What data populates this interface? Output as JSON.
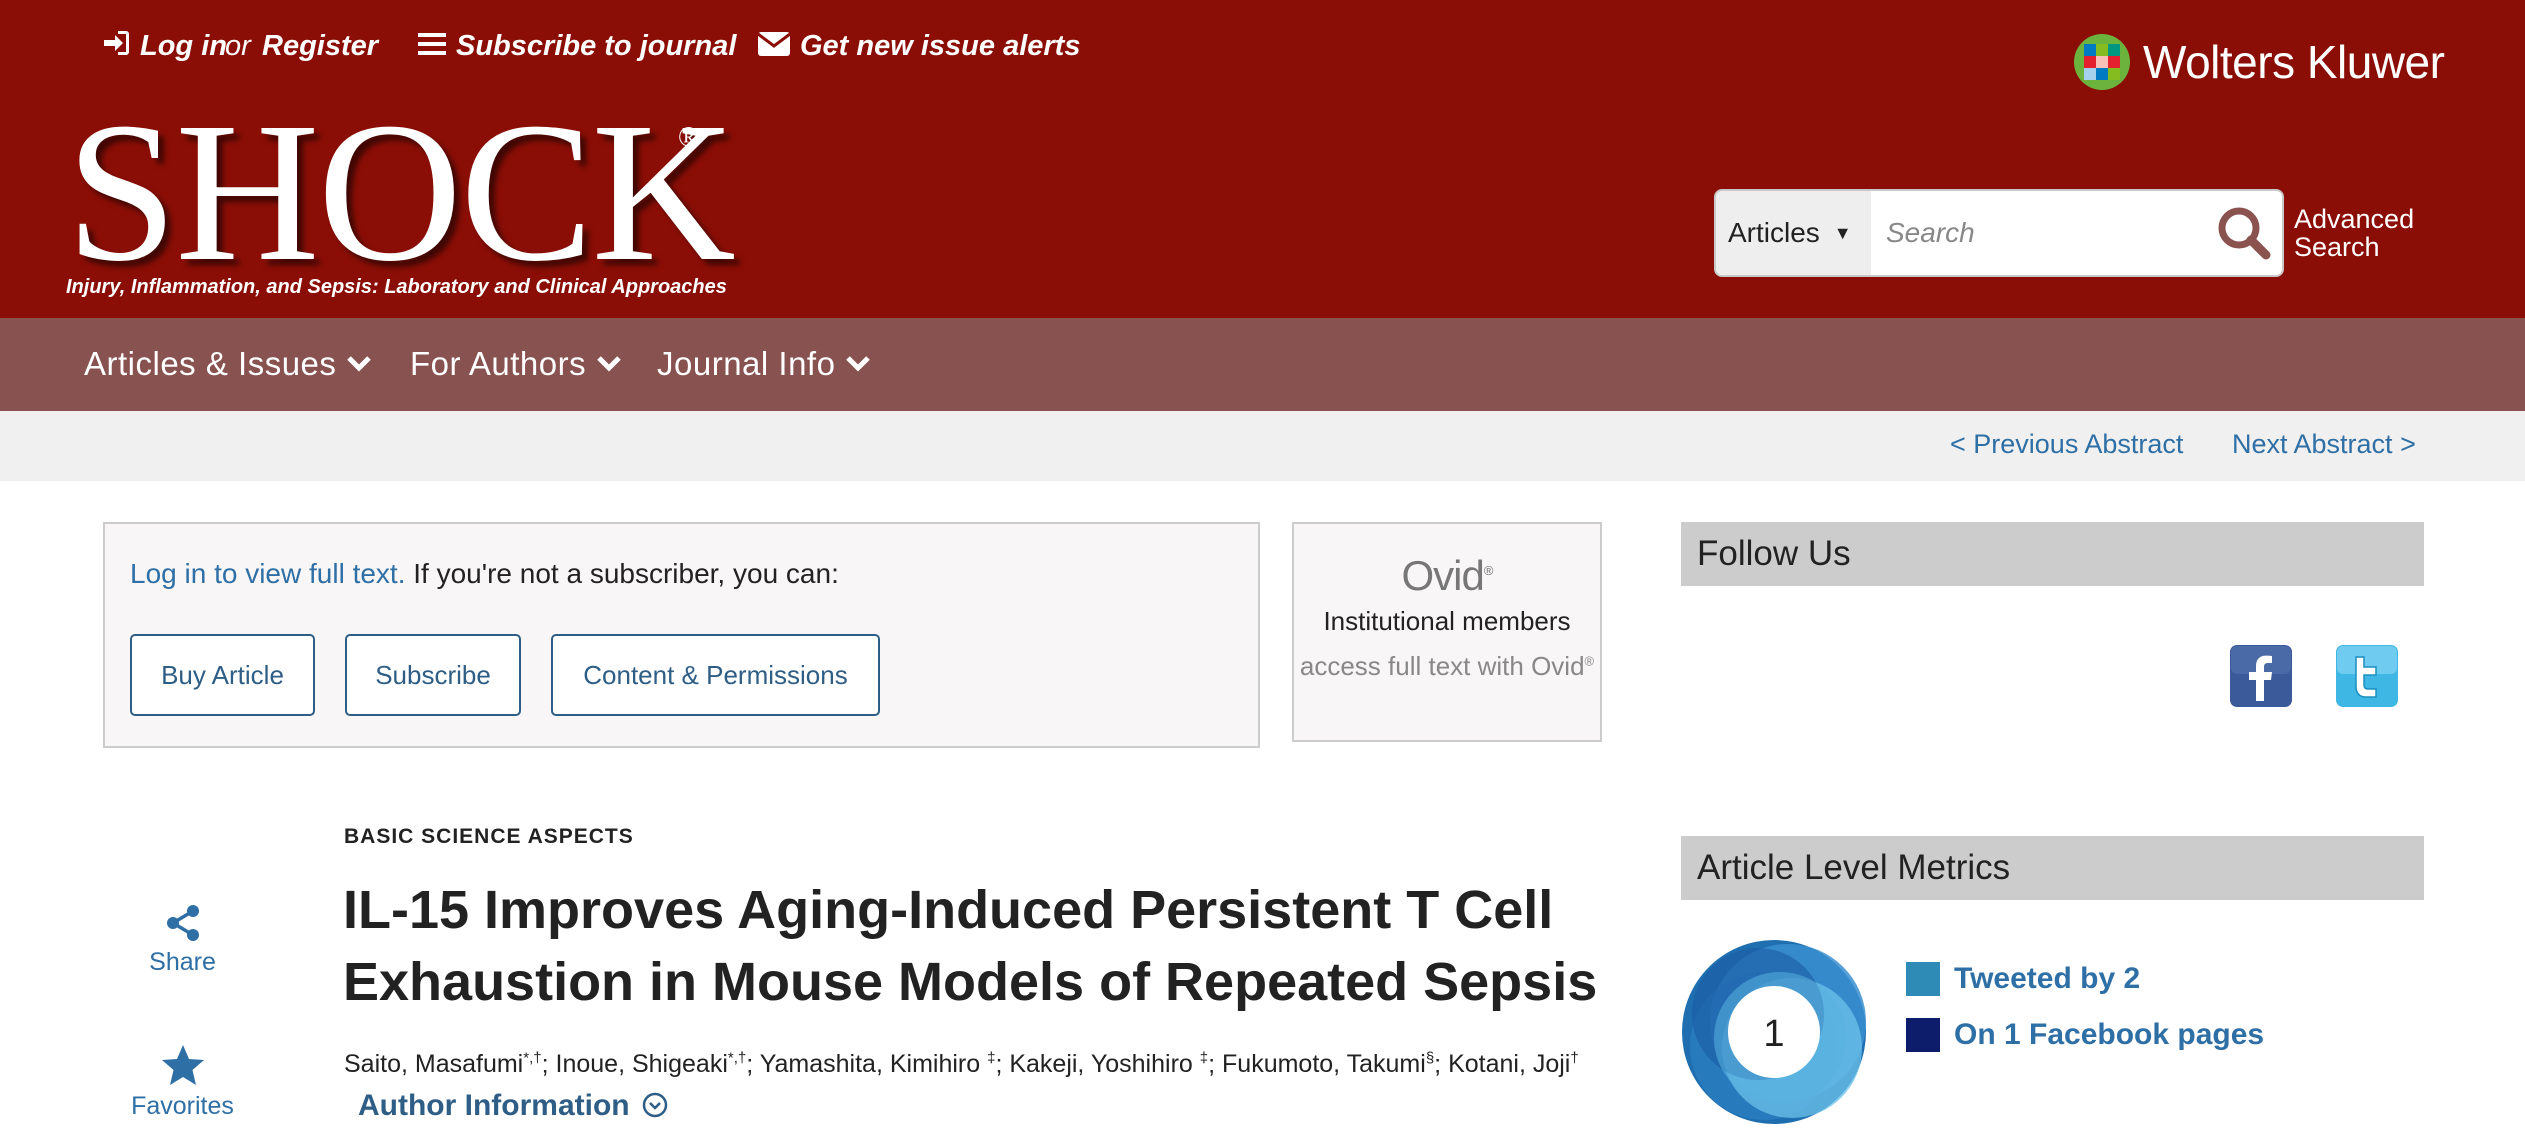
{
  "header": {
    "login": "Log in",
    "or": "or",
    "register": "Register",
    "subscribe": "Subscribe to journal",
    "alerts": "Get new issue alerts",
    "publisher": "Wolters Kluwer",
    "journal_logo": "SHOCK",
    "logo_mark": "®",
    "tagline": "Injury, Inflammation, and Sepsis: Laboratory and Clinical Approaches",
    "search": {
      "scope": "Articles",
      "placeholder": "Search",
      "advanced": "Advanced Search"
    },
    "colors": {
      "header_bg": "#8b0e06",
      "nav_bg": "#875250",
      "accent": "#2e6fa6"
    }
  },
  "nav": {
    "items": [
      "Articles & Issues",
      "For Authors",
      "Journal Info"
    ]
  },
  "pager": {
    "previous": "< Previous Abstract",
    "next": "Next Abstract >"
  },
  "access": {
    "login_text": "Log in to view full text.",
    "rest_text": " If you're not a subscriber, you can:",
    "buttons": [
      "Buy Article",
      "Subscribe",
      "Content & Permissions"
    ]
  },
  "ovid": {
    "logo": "Ovid",
    "text_1": "Institutional members",
    "text_link": "access full text with Ovid",
    "reg": "®"
  },
  "sidebar": {
    "follow_us": "Follow Us",
    "social_icons": [
      "facebook-icon",
      "twitter-icon"
    ],
    "metrics_title": "Article Level Metrics",
    "altmetric_score": "1",
    "metrics": [
      {
        "label": "Tweeted by 2",
        "color": "#2e8bb5"
      },
      {
        "label": "On 1 Facebook pages",
        "color": "#0d1d6b"
      }
    ]
  },
  "article": {
    "category": "BASIC SCIENCE ASPECTS",
    "title": "IL-15 Improves Aging-Induced Persistent T Cell Exhaustion in Mouse Models of Repeated Sepsis",
    "authors": [
      {
        "name": "Saito, Masafumi",
        "sup": "*,†"
      },
      {
        "name": "Inoue, Shigeaki",
        "sup": "*,†"
      },
      {
        "name": "Yamashita, Kimihiro",
        "sup": "‡"
      },
      {
        "name": "Kakeji, Yoshihiro",
        "sup": "‡"
      },
      {
        "name": "Fukumoto, Takumi",
        "sup": "§"
      },
      {
        "name": "Kotani, Joji",
        "sup": "†"
      }
    ],
    "author_info": "Author Information",
    "tools": {
      "share": "Share",
      "favorites": "Favorites"
    }
  }
}
